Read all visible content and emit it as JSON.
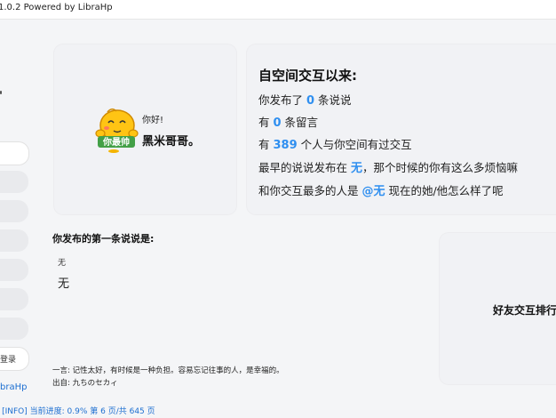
{
  "window": {
    "title": "1.0.2 Powered by LibraHp"
  },
  "sidebar": {
    "last_button_label": "登录",
    "brand": "braHp"
  },
  "profile": {
    "greeting": "你好!",
    "nickname": "黑米哥哥。",
    "avatar_badge": "你最帅",
    "avatar_icon": "smiley-emoji-icon"
  },
  "stats": {
    "title": "自空间交互以来:",
    "line1": {
      "pre": "你发布了 ",
      "value": "0",
      "post": " 条说说"
    },
    "line2": {
      "pre": "有 ",
      "value": "0",
      "post": " 条留言"
    },
    "line3": {
      "pre": "有 ",
      "value": "389",
      "post": " 个人与你空间有过交互"
    },
    "line4": {
      "pre": "最早的说说发布在 ",
      "value": "无",
      "post": "，那个时候的你有这么多烦恼嘛"
    },
    "line5": {
      "pre": "和你交互最多的人是 ",
      "value": "@无",
      "post": " 现在的她/他怎么样了呢"
    }
  },
  "first_post": {
    "title": "你发布的第一条说说是:",
    "small": "无",
    "big": "无"
  },
  "quote": {
    "text": "一言: 记性太好，有时候是一种负担。容易忘记往事的人，是幸福的。",
    "source": "出自: 九ちのセカィ"
  },
  "ranking": {
    "title": "好友交互排行"
  },
  "status": {
    "text": "- [INFO] 当前进度: 0.9% 第 6 页/共 645 页"
  },
  "colors": {
    "accent": "#2f8ff0",
    "link": "#1d6fd1"
  }
}
